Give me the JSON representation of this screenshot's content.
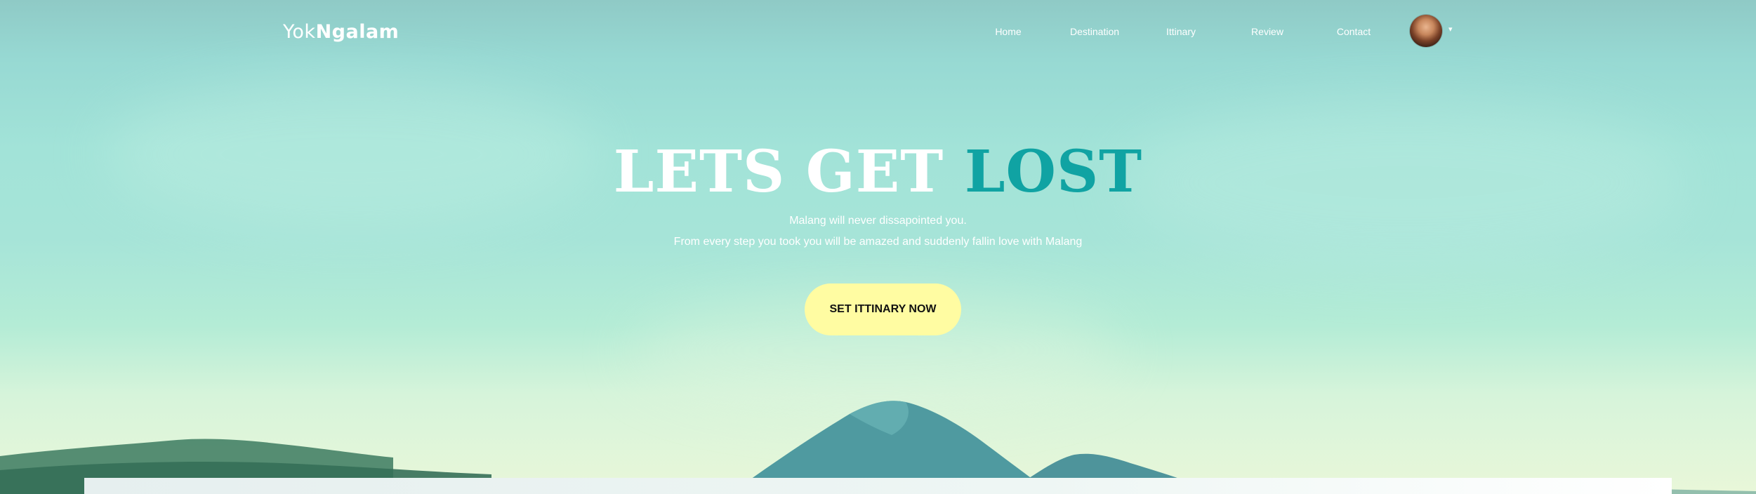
{
  "brand": {
    "light": "Yok",
    "bold": "Ngalam"
  },
  "nav": {
    "items": [
      {
        "label": "Home"
      },
      {
        "label": "Destination"
      },
      {
        "label": "Ittinary"
      },
      {
        "label": "Review"
      },
      {
        "label": "Contact"
      }
    ],
    "avatar_caret": "▾"
  },
  "hero": {
    "headline_white": "LETS GET",
    "headline_accent": "LOST",
    "subline_1": "Malang will never dissapointed you.",
    "subline_2": "From every step you took you will be amazed and suddenly fallin love with Malang",
    "cta_label": "SET ITTINARY NOW"
  },
  "colors": {
    "accent": "#10a3a3",
    "cta_background": "#fffca2",
    "sky_top": "#8fcac6",
    "sky_bottom": "#e9f7d9"
  }
}
